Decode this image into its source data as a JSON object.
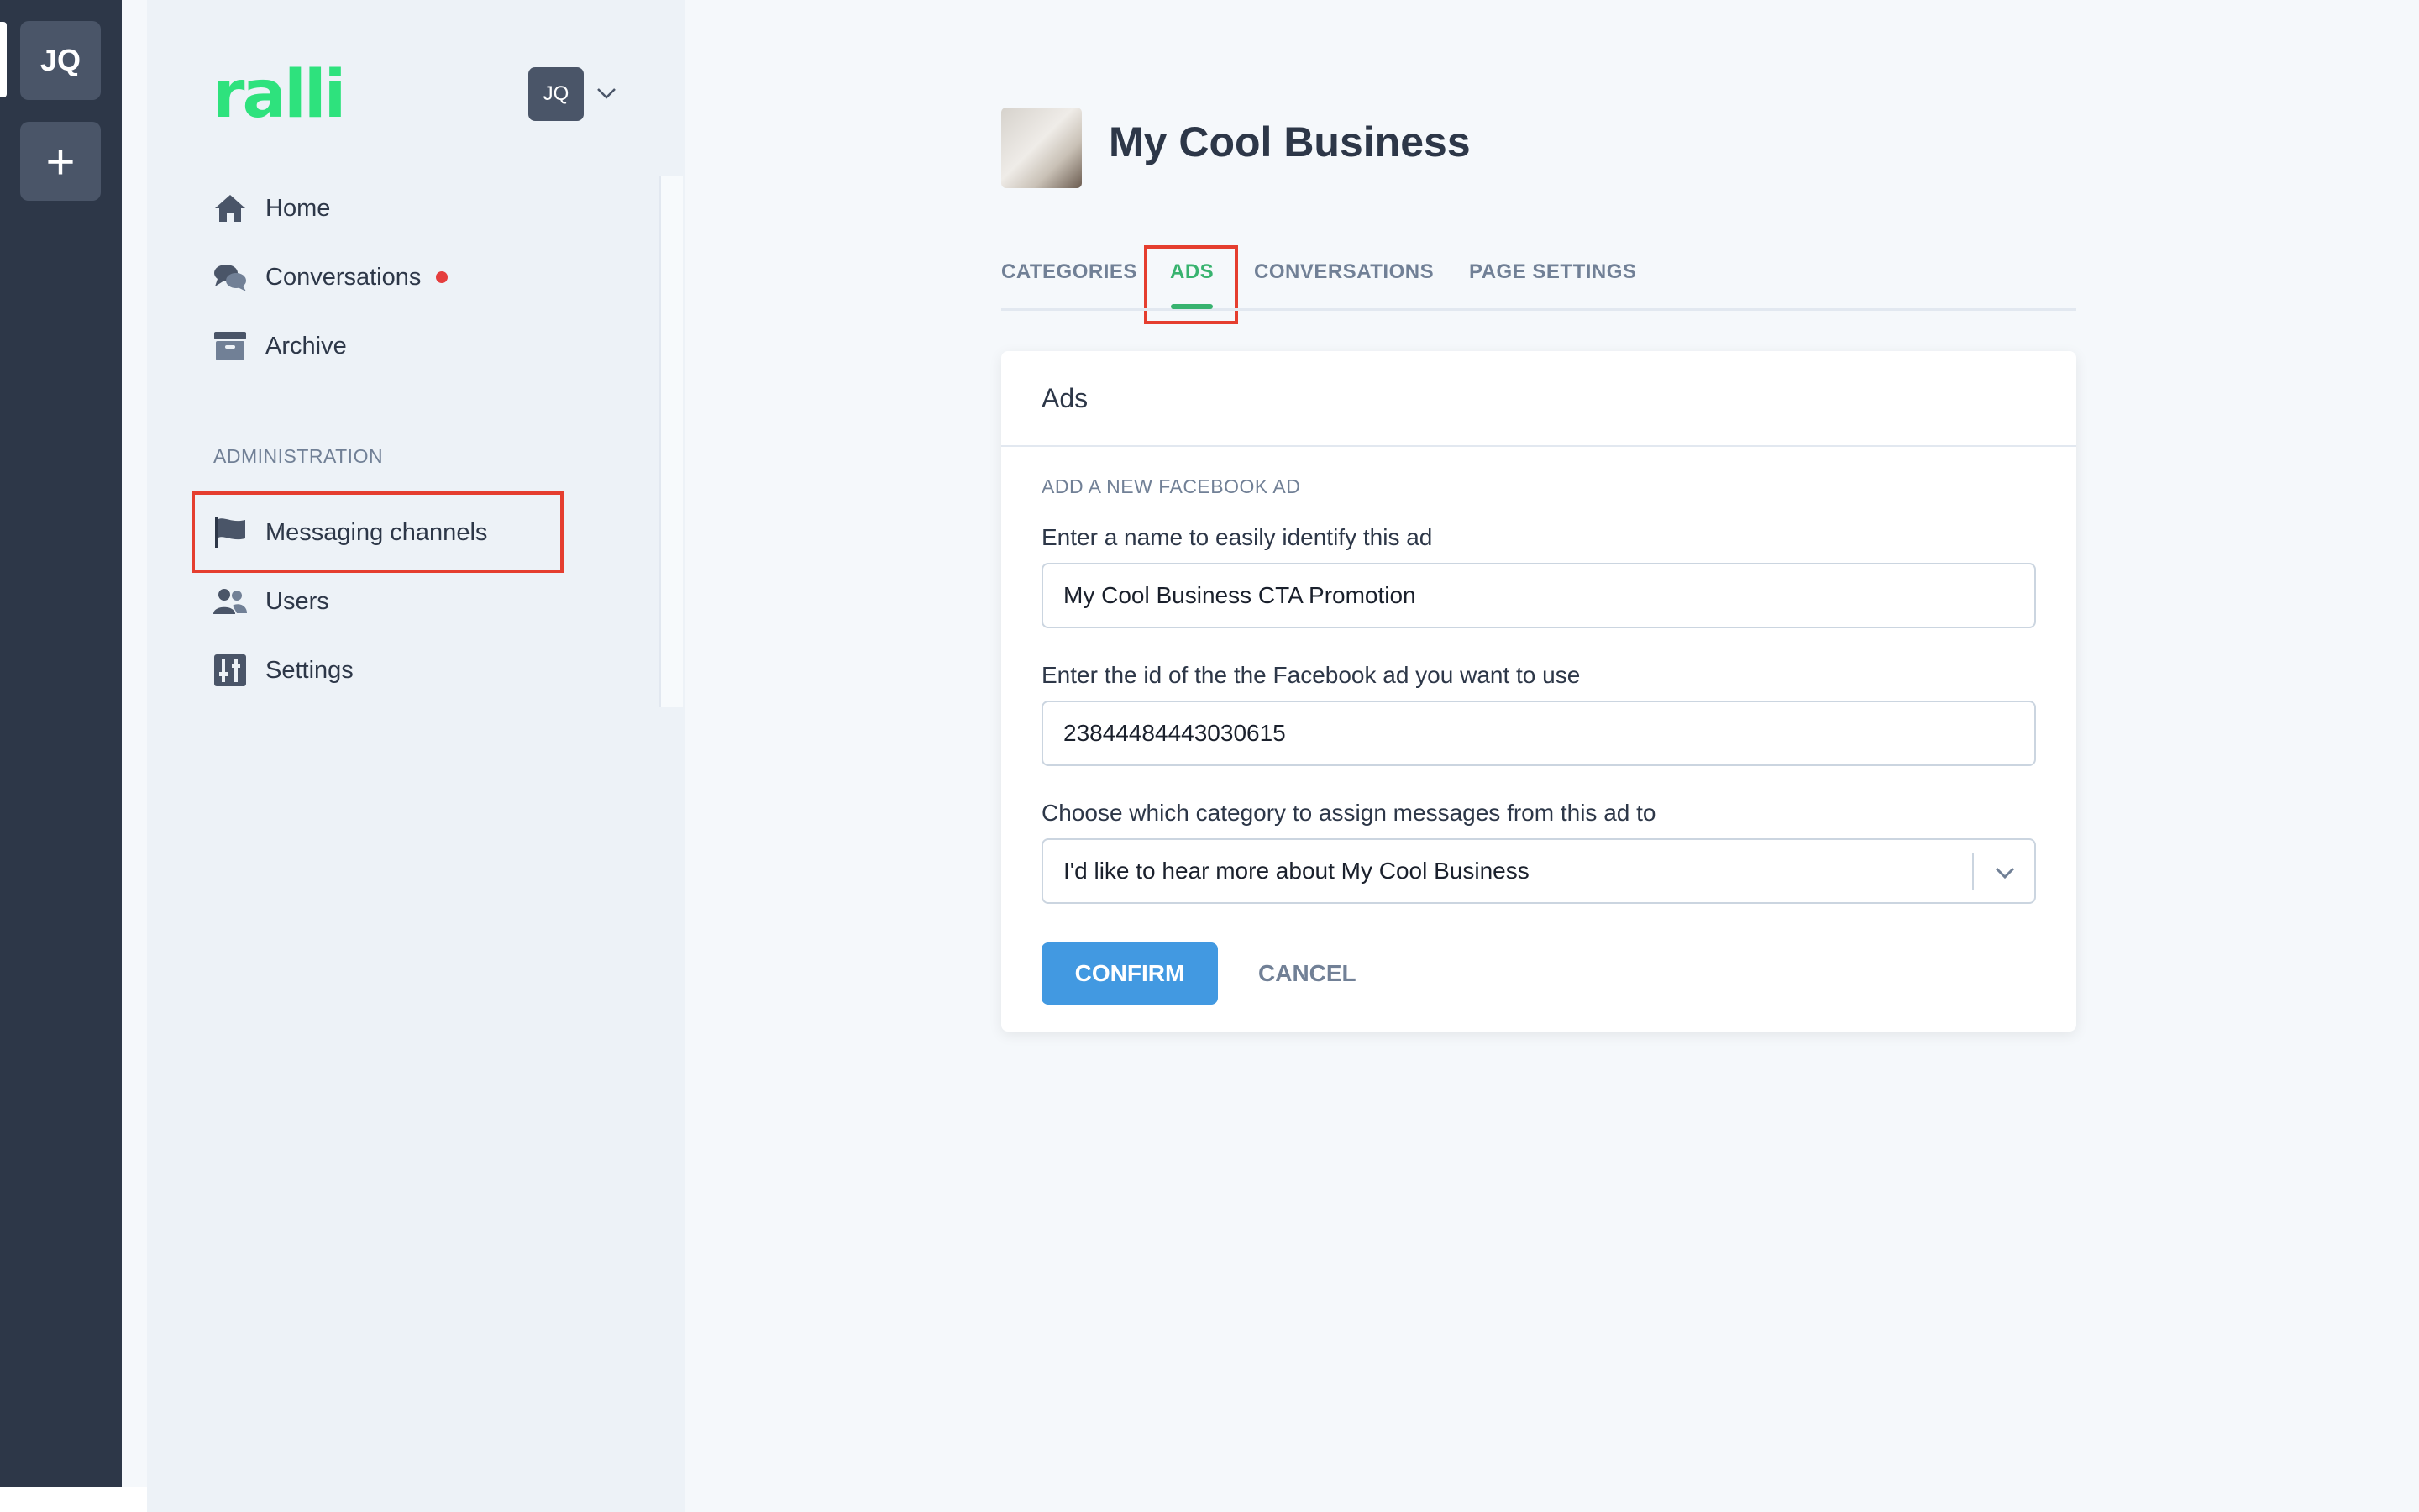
{
  "rail": {
    "workspace_initials": "JQ",
    "add_symbol": "+"
  },
  "sidebar": {
    "logo_text": "ralli",
    "user_initials": "JQ",
    "nav": [
      {
        "label": "Home",
        "icon": "home-icon"
      },
      {
        "label": "Conversations",
        "icon": "chat-icon",
        "unread": true
      },
      {
        "label": "Archive",
        "icon": "archive-icon"
      }
    ],
    "admin_label": "ADMINISTRATION",
    "admin_nav": [
      {
        "label": "Messaging channels",
        "icon": "flag-icon"
      },
      {
        "label": "Users",
        "icon": "users-icon"
      },
      {
        "label": "Settings",
        "icon": "settings-icon"
      }
    ]
  },
  "main": {
    "business_name": "My Cool Business",
    "tabs": [
      {
        "label": "CATEGORIES"
      },
      {
        "label": "ADS",
        "active": true
      },
      {
        "label": "CONVERSATIONS"
      },
      {
        "label": "PAGE SETTINGS"
      }
    ],
    "card": {
      "title": "Ads",
      "subtitle": "ADD A NEW FACEBOOK AD",
      "name_label": "Enter a name to easily identify this ad",
      "name_value": "My Cool Business CTA Promotion",
      "id_label": "Enter the id of the the Facebook ad you want to use",
      "id_value": "23844484443030615",
      "category_label": "Choose which category to assign messages from this ad to",
      "category_value": "I'd like to hear more about My Cool Business",
      "confirm_label": "CONFIRM",
      "cancel_label": "CANCEL"
    }
  },
  "colors": {
    "brand_green": "#2ee27d",
    "active_tab": "#38b36f",
    "primary_button": "#4299e1",
    "highlight_red": "#e53e2f",
    "unread_dot": "#e53e3e"
  }
}
